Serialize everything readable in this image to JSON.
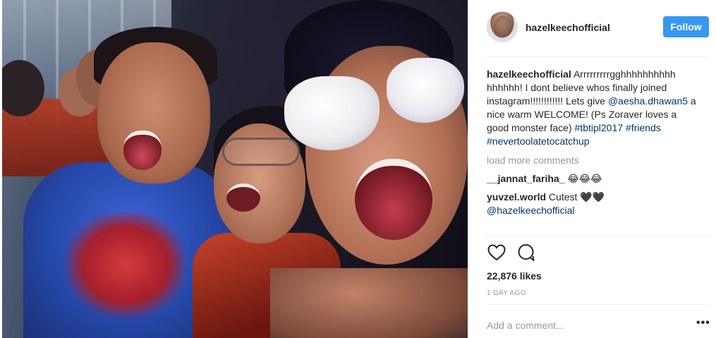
{
  "post": {
    "username": "hazelkeechofficial",
    "follow_label": "Follow",
    "caption": {
      "username": "hazelkeechofficial",
      "text_1": " Arrrrrrrrrgghhhhhhhhhh hhhhhh! I dont believe whos finally joined instagram!!!!!!!!!!!! Lets give ",
      "mention": "@aesha.dhawan5",
      "text_2": " a nice warm WELCOME! (Ps Zoraver loves a good monster face) ",
      "hashtag_1": "#tbtipl2017",
      "hashtag_2": "#friends",
      "hashtag_3": "#nevertoolatetocatchup"
    },
    "load_more": "load more comments",
    "comments": [
      {
        "username": "__jannat_fariha_",
        "text": " 😂😂😂",
        "mention": ""
      },
      {
        "username": "yuvzel.world",
        "text": " Cutest 🖤🖤",
        "mention": "@hazelkeechofficial"
      }
    ],
    "likes": "22,876 likes",
    "time": "1 DAY AGO",
    "add_comment_placeholder": "Add a comment...",
    "more_options": "•••"
  },
  "icons": {
    "like": "heart-icon",
    "comment": "comment-icon",
    "more": "more-options-icon"
  },
  "colors": {
    "follow_button": "#3897f0",
    "link": "#003569",
    "muted": "#999999"
  }
}
